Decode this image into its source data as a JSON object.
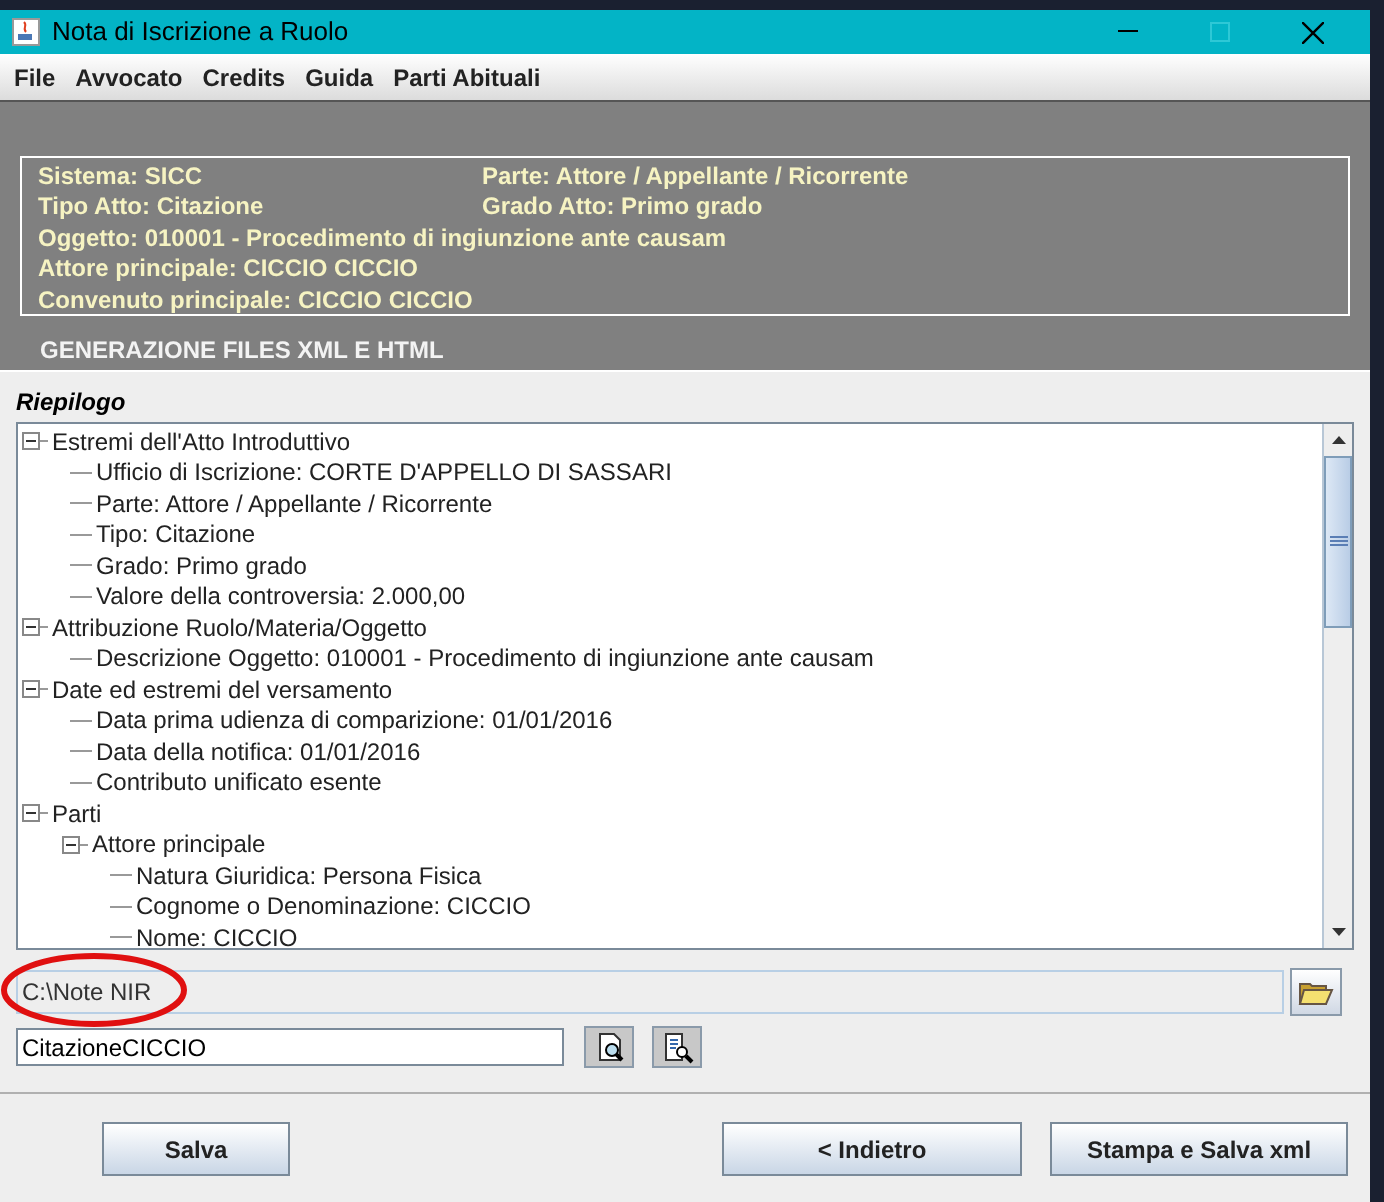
{
  "window": {
    "title": "Nota di Iscrizione a Ruolo"
  },
  "menu": [
    "File",
    "Avvocato",
    "Credits",
    "Guida",
    "Parti Abituali"
  ],
  "summary_box": {
    "lines": [
      [
        "Sistema: SICC",
        "Parte: Attore / Appellante / Ricorrente"
      ],
      [
        "Tipo Atto: Citazione",
        "Grado Atto: Primo grado"
      ],
      [
        "Oggetto: 010001 - Procedimento di ingiunzione ante causam"
      ],
      [
        "Attore principale: CICCIO CICCIO"
      ],
      [
        "Convenuto principale: CICCIO CICCIO"
      ]
    ],
    "caption": "GENERAZIONE FILES XML E HTML"
  },
  "tree": {
    "title": "Riepilogo",
    "items": [
      {
        "label": "Estremi dell'Atto Introduttivo",
        "expanded": true,
        "children": [
          {
            "label": "Ufficio di Iscrizione: CORTE D'APPELLO DI SASSARI"
          },
          {
            "label": "Parte: Attore / Appellante / Ricorrente"
          },
          {
            "label": "Tipo: Citazione"
          },
          {
            "label": "Grado: Primo grado"
          },
          {
            "label": "Valore della controversia: 2.000,00"
          }
        ]
      },
      {
        "label": "Attribuzione Ruolo/Materia/Oggetto",
        "expanded": true,
        "children": [
          {
            "label": "Descrizione Oggetto: 010001 - Procedimento di ingiunzione ante causam"
          }
        ]
      },
      {
        "label": "Date ed estremi del versamento",
        "expanded": true,
        "children": [
          {
            "label": "Data prima udienza di comparizione: 01/01/2016"
          },
          {
            "label": "Data della notifica: 01/01/2016"
          },
          {
            "label": "Contributo unificato esente"
          }
        ]
      },
      {
        "label": "Parti",
        "expanded": true,
        "children": [
          {
            "label": "Attore principale",
            "expanded": true,
            "children": [
              {
                "label": "Natura Giuridica: Persona Fisica"
              },
              {
                "label": "Cognome o Denominazione: CICCIO"
              },
              {
                "label": "Nome: CICCIO"
              }
            ]
          }
        ]
      }
    ]
  },
  "folder_path": "C:\\Note NIR",
  "file_name": "CitazioneCICCIO",
  "buttons": [
    "Salva",
    "< Indietro",
    "Stampa e Salva xml"
  ]
}
